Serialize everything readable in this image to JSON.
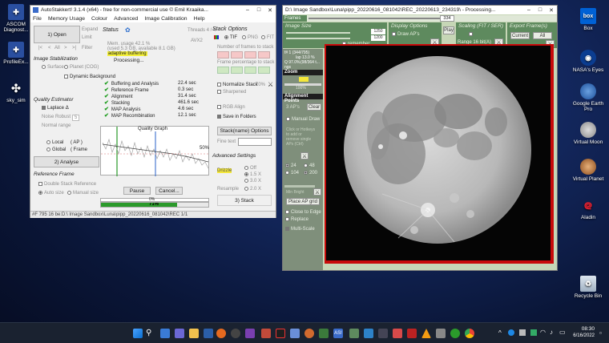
{
  "desktop": {
    "left_icons": [
      {
        "label": "ASCOM Diagnost...",
        "icon": "ascom-diagnostics-icon"
      },
      {
        "label": "ProfileEx...",
        "icon": "ascom-profile-icon"
      },
      {
        "label": "sky_sim",
        "icon": "sky-sim-icon"
      }
    ],
    "right_icons": [
      {
        "label": "Box",
        "icon": "box-icon"
      },
      {
        "label": "NASA's Eyes",
        "icon": "nasa-eyes-icon"
      },
      {
        "label": "Google Earth Pro",
        "icon": "google-earth-icon"
      },
      {
        "label": "Virtual Moon",
        "icon": "virtual-moon-icon"
      },
      {
        "label": "Virtual Planet",
        "icon": "virtual-planet-icon"
      },
      {
        "label": "Aladin",
        "icon": "aladin-icon"
      }
    ],
    "recycle_bin": "Recycle Bin"
  },
  "autostakkert": {
    "title": "AutoStakkert! 3.1.4 (x64) - free for non-commercial use © Emil Kraaika...",
    "menu": [
      "File",
      "Memory Usage",
      "Colour",
      "Advanced",
      "Image Calibration",
      "Help"
    ],
    "open_button": "1) Open",
    "expand": "Expand",
    "limit": "Limit",
    "filter": "Filter",
    "image_stabilization_title": "Image Stabilization",
    "surface": "Surface",
    "planet_cog": "Planet (COG)",
    "dynamic_background": "Dynamic Background",
    "quality_estimator_title": "Quality Estimator",
    "laplace": "Laplace",
    "laplace_mark": "Δ",
    "noise_robust": "Noise Robust",
    "noise_robust_value": "5",
    "normal_range": "Normal range",
    "local": "Local",
    "global": "Global",
    "ap": "( AP )",
    "frame": "( Frame",
    "analyse_button": "2) Analyse",
    "reference_frame_title": "Reference Frame",
    "double_stack_reference": "Double Stack Reference",
    "auto_size": "Auto size",
    "manual_size": "Manual size",
    "manual_size_value": "1",
    "status_title": "Status",
    "threads": "Threads 4 / 4",
    "avx2": "AVX2",
    "mem_usage": "Mem. usage 42.1 %",
    "mem_detail": "(used 5.3 GB, available 8.1 GB)",
    "adaptive_buffering": "adaptive buffering",
    "processing": "Processing...",
    "steps": [
      {
        "label": "Buffering and Analysis",
        "time": "22.4 sec"
      },
      {
        "label": "Reference Frame",
        "time": "0.3 sec"
      },
      {
        "label": "Alignment",
        "time": "31.4 sec"
      },
      {
        "label": "Stacking",
        "time": "461.6 sec"
      },
      {
        "label": "MAP Analysis",
        "time": "4.6 sec"
      },
      {
        "label": "MAP Recombination",
        "time": "12.1 sec"
      }
    ],
    "quality_graph_title": "Quality Graph",
    "quality_graph_marker": "50%",
    "pause_button": "Pause",
    "cancel_button": "Cancel...",
    "progress_top": "0%",
    "progress_bottom": "71%",
    "progress_value": 0.71,
    "stack_options_title": "Stack Options",
    "format_tif": "TIF",
    "format_png": "PNG",
    "format_fit": "FIT",
    "frames_to_stack_label": "Number of frames to stack",
    "frame_percentage_label": "Frame percentage to stack",
    "normalize_stack": "Normalize Stack",
    "normalize_value": "70%",
    "sharpened": "Sharpened",
    "rgb_align": "RGB Align",
    "save_in_folders": "Save in Folders",
    "stack_name_options": "Stack(name) Options",
    "fine_text": "Fine text",
    "advanced_settings_title": "Advanced Settings",
    "drizzle": "Drizzle",
    "drizzle_off": "Off",
    "drizzle_15": "1.5 X",
    "drizzle_30": "3.0 X",
    "resample": "Resample",
    "resample_20": "2.0 X",
    "stack_button": "3) Stack",
    "statusbar": "#F 795     16 be:D:\\ Image Sandbox\\Luna\\pipp_20220616_081042\\REC 1/1"
  },
  "viewer": {
    "title": "D:\\ Image Sandbox\\Luna\\pipp_20220616_081042\\REC_20220613_234319\\ - Processing...",
    "frames_label": "Frames",
    "frames_value": "334",
    "image_size_title": "Image Size",
    "size_w": "1250",
    "size_h": "1200",
    "remember": "remember",
    "display_options_title": "Display Options",
    "draw_aps": "Draw AP's",
    "play": "Play",
    "scaling_title": "Scaling (FIT / SER)",
    "range_label": "Range 16 bit(A)",
    "export_title": "Export Frame(s)",
    "current_button": "Current",
    "all_button": "All",
    "info_1": "f# 1 (344/795)",
    "info_2": "lap 13.0 %",
    "info_3": "Q 97.0%",
    "info_4": "(98/364 t...",
    "info_5": "ngs",
    "zoom_title": "Zoom",
    "zoom_value": "100%",
    "alignment_points_title": "Alignment Points",
    "ap_count": "3 AP's",
    "clear_button": "Clear",
    "manual_draw": "Manual Draw",
    "ap_hint": "Click or Hotkeys\nto add or\nremove single\nAPs (Ctrl)",
    "ap_sizes": [
      "24",
      "48",
      "104",
      "200"
    ],
    "min_bright": "Min Bright",
    "place_ap_grid": "Place AP grid",
    "close_to_edge": "Close to Edge",
    "replace": "Replace",
    "multi_scale": "Multi-Scale"
  },
  "taskbar": {
    "time": "08:30",
    "date": "6/16/2022",
    "icons": [
      "start-icon",
      "search-icon",
      "widgets-icon",
      "chat-icon",
      "teams-icon",
      "firefox-icon",
      "app-icon",
      "app-icon",
      "app-icon",
      "app-icon",
      "app-icon",
      "app-icon",
      "app-icon",
      "autostakkert-icon",
      "app-icon",
      "app-icon",
      "app-icon",
      "app-icon",
      "app-icon",
      "vlc-icon",
      "app-icon",
      "app-icon",
      "chrome-icon"
    ]
  }
}
